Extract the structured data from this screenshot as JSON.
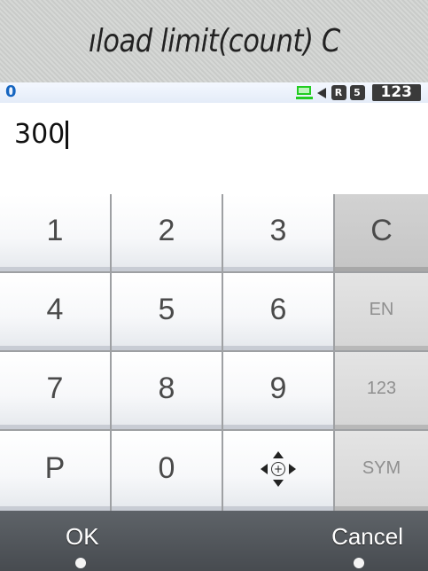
{
  "title": "ıload limit(count)     C",
  "status_bar": {
    "char_count": "0",
    "indicators": [
      {
        "icon": "pc-connection-icon"
      },
      {
        "icon": "speaker-icon"
      },
      {
        "icon": "r-indicator-icon",
        "label": "R"
      },
      {
        "icon": "sim-indicator-icon",
        "label": "5"
      }
    ],
    "input_mode": "123"
  },
  "input": {
    "value": "300"
  },
  "keypad": {
    "keys": [
      "1",
      "2",
      "3",
      "C",
      "4",
      "5",
      "6",
      "EN",
      "7",
      "8",
      "9",
      "123",
      "P",
      "0",
      "",
      "SYM"
    ],
    "nav_center": "+"
  },
  "softkeys": {
    "left": "OK",
    "right": "Cancel"
  },
  "colors": {
    "char_count": "#1565c0",
    "softkey_bar": "#52575c"
  }
}
